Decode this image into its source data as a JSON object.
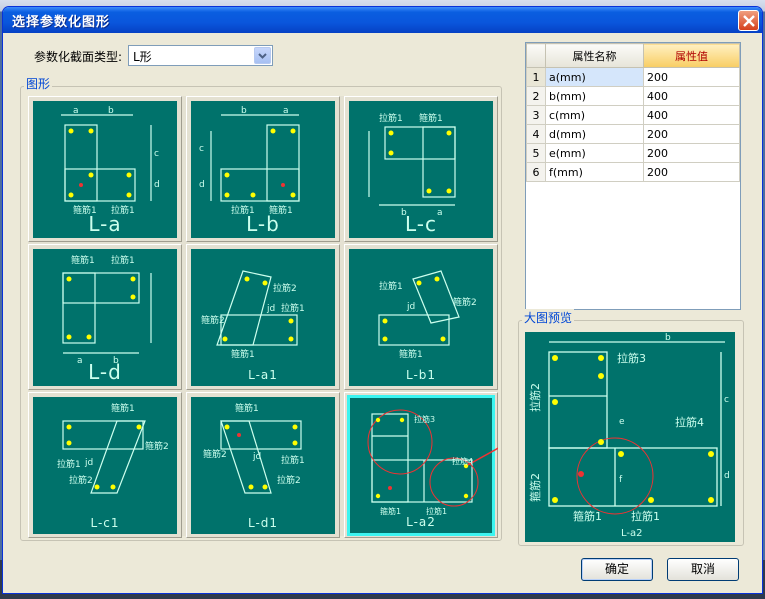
{
  "dialog": {
    "title": "选择参数化图形"
  },
  "section_type": {
    "label": "参数化截面类型:",
    "selected": "L形"
  },
  "shapes_group": {
    "title": "图形",
    "items": [
      {
        "caption": "L-a"
      },
      {
        "caption": "L-b"
      },
      {
        "caption": "L-c"
      },
      {
        "caption": "L-d"
      },
      {
        "caption": "L-a1"
      },
      {
        "caption": "L-b1"
      },
      {
        "caption": "L-c1"
      },
      {
        "caption": "L-d1"
      },
      {
        "caption": "L-a2"
      }
    ],
    "selected": "L-a2"
  },
  "drawing_labels": {
    "stirrup1": "箍筋1",
    "stirrup2": "箍筋2",
    "tie1": "拉筋1",
    "tie2": "拉筋2",
    "tie3": "拉筋3",
    "tie4": "拉筋4",
    "jd": "jd",
    "a": "a",
    "b": "b",
    "c": "c",
    "d": "d",
    "e": "e",
    "f": "f"
  },
  "props": {
    "headers": {
      "name": "属性名称",
      "value": "属性值"
    },
    "rows": [
      {
        "n": "1",
        "name": "a(mm)",
        "value": "200"
      },
      {
        "n": "2",
        "name": "b(mm)",
        "value": "400"
      },
      {
        "n": "3",
        "name": "c(mm)",
        "value": "400"
      },
      {
        "n": "4",
        "name": "d(mm)",
        "value": "200"
      },
      {
        "n": "5",
        "name": "e(mm)",
        "value": "200"
      },
      {
        "n": "6",
        "name": "f(mm)",
        "value": "200"
      }
    ]
  },
  "preview": {
    "title": "大图预览",
    "caption": "L-a2"
  },
  "buttons": {
    "ok": "确定",
    "cancel": "取消"
  },
  "colors": {
    "drawing_bg": "#00726b",
    "highlight": "#3cf4f0",
    "title_bar": "#0a56dc"
  }
}
